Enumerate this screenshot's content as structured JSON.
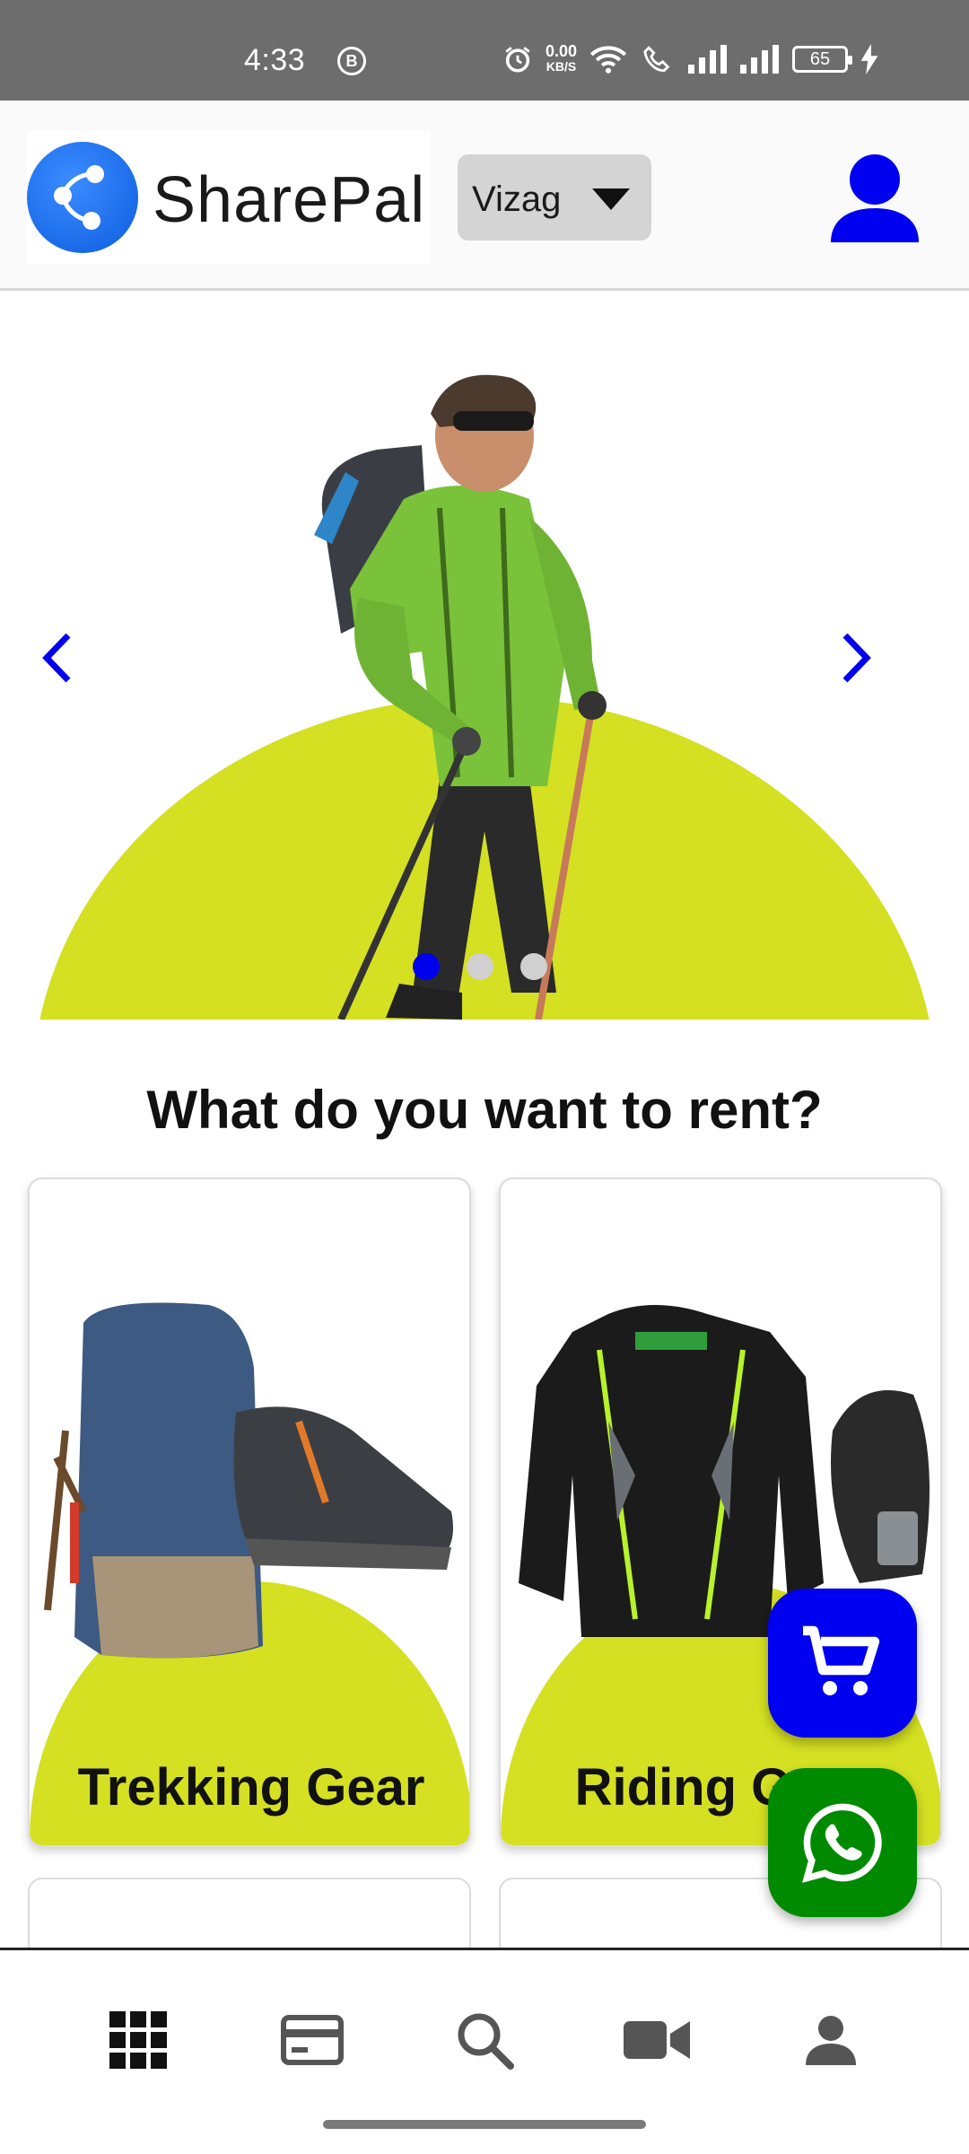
{
  "status_bar": {
    "time": "4:33",
    "b_badge": "B",
    "speed_value": "0.00",
    "speed_unit": "KB/S",
    "battery": "65"
  },
  "header": {
    "logo_text": "SharePal",
    "city": "Vizag"
  },
  "carousel": {
    "slide_count": 3,
    "active_index": 0
  },
  "main": {
    "section_title": "What do you want to rent?",
    "categories": [
      {
        "label": "Trekking Gear"
      },
      {
        "label": "Riding Gear"
      }
    ]
  },
  "bottom_nav": {
    "items": [
      "grid-icon",
      "card-icon",
      "search-icon",
      "video-icon",
      "profile-icon"
    ]
  },
  "colors": {
    "accent": "#0000f0",
    "arc": "#d4e021",
    "whatsapp": "#008a00"
  }
}
